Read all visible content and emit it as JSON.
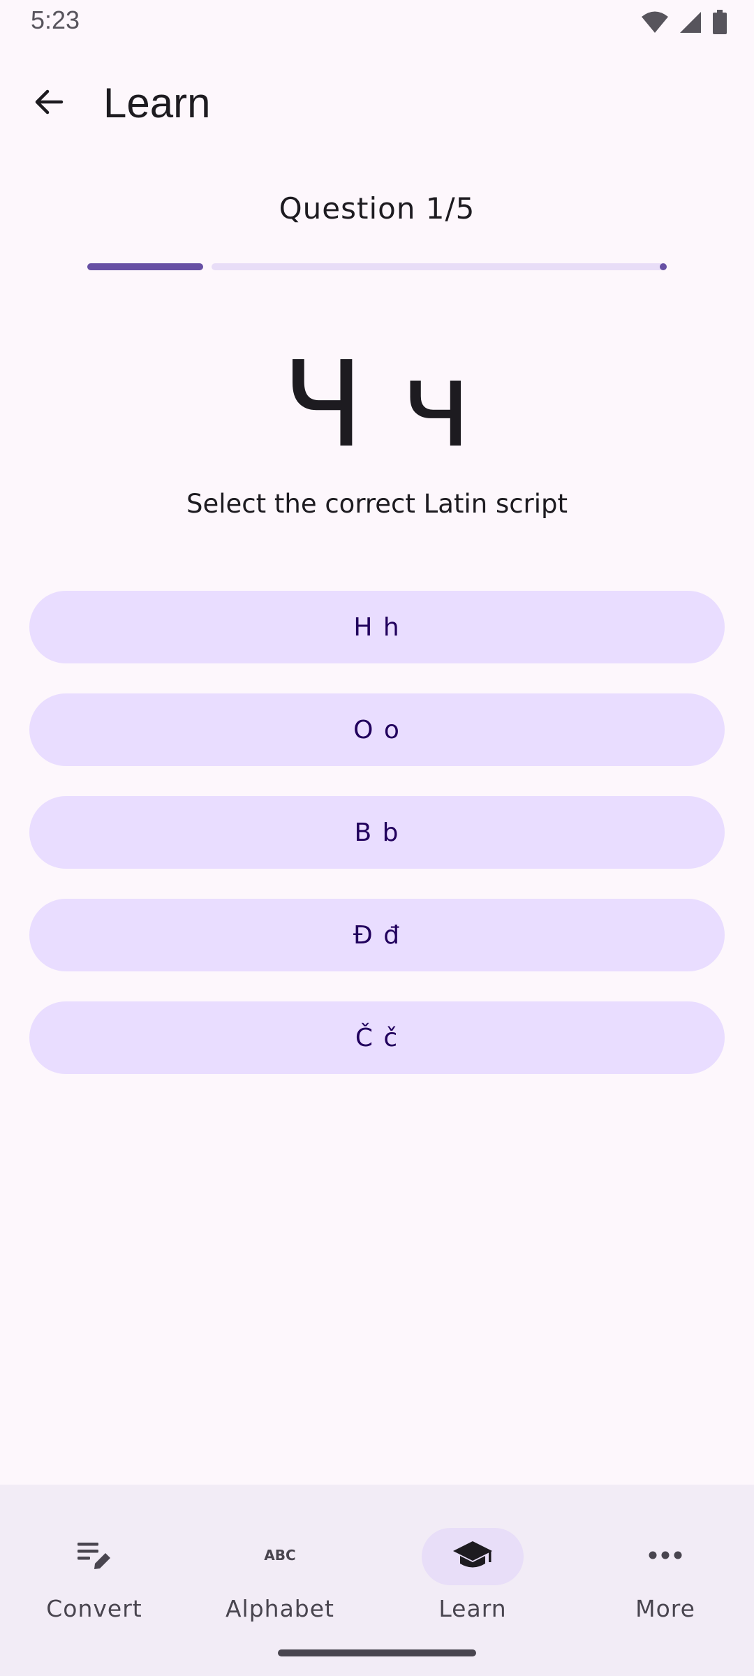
{
  "status_bar": {
    "time": "5:23",
    "icons": [
      "wifi-icon",
      "signal-icon",
      "battery-icon"
    ]
  },
  "app_bar": {
    "title": "Learn",
    "back_icon": "arrow-back-icon"
  },
  "quiz": {
    "question_label": "Question 1/5",
    "progress_fraction": 0.2,
    "letter": "Ч ч",
    "instruction": "Select the correct Latin script",
    "options": [
      "H h",
      "O o",
      "B b",
      "Đ đ",
      "Č č"
    ]
  },
  "bottom_nav": {
    "items": [
      {
        "label": "Convert",
        "icon": "convert-icon",
        "active": false
      },
      {
        "label": "Alphabet",
        "icon": "abc-icon",
        "active": false
      },
      {
        "label": "Learn",
        "icon": "school-icon",
        "active": true
      },
      {
        "label": "More",
        "icon": "more-horiz-icon",
        "active": false
      }
    ]
  },
  "colors": {
    "background": "#FDF7FC",
    "primary": "#6750A4",
    "option_bg": "#E9DDFF",
    "option_text": "#21005D",
    "nav_bg": "#F2ECF6",
    "nav_indicator": "#E8DEF8"
  }
}
